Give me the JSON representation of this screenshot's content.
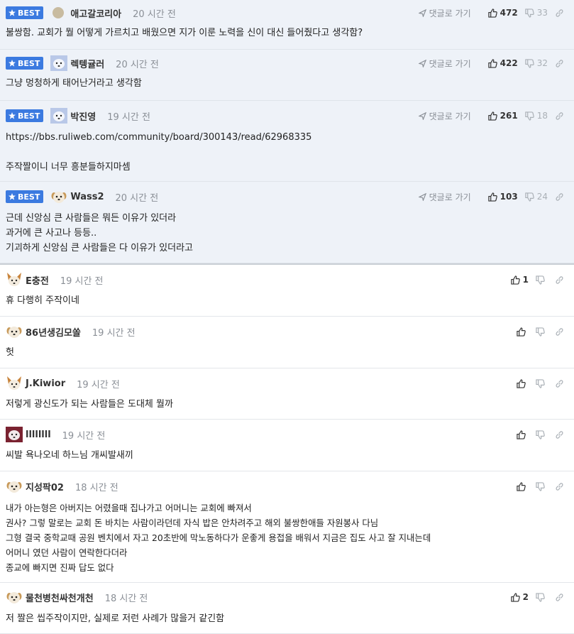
{
  "ui": {
    "best_label": "BEST",
    "reply_label": "댓글로 가기"
  },
  "best_comments": [
    {
      "nick": "애고갈코리아",
      "time": "20 시간 전",
      "up": "472",
      "down": "33",
      "avatar": "circle-avatar",
      "body": "불쌍함. 교회가 뭘 어떻게 가르치고 배웠으면 지가 이룬 노력을 신이 대신 들어줬다고 생각함?"
    },
    {
      "nick": "렉텡귤러",
      "time": "20 시간 전",
      "up": "422",
      "down": "32",
      "avatar": "white-dog-avatar",
      "body": "그냥 멍청하게 태어난거라고 생각함"
    },
    {
      "nick": "박진영",
      "time": "19 시간 전",
      "up": "261",
      "down": "18",
      "avatar": "white-dog-avatar",
      "body": "https://bbs.ruliweb.com/community/board/300143/read/62968335\n\n주작짤이니 너무 흥분들하지마셈"
    },
    {
      "nick": "Wass2",
      "time": "20 시간 전",
      "up": "103",
      "down": "24",
      "avatar": "puppy-avatar",
      "body": "근데 신앙심 큰 사람들은 뭐든 이유가 있더라\n과거에 큰 사고나 등등..\n기괴하게 신앙심 큰 사람들은 다 이유가 있더라고"
    }
  ],
  "comments": [
    {
      "nick": "E충전",
      "time": "19 시간 전",
      "up": "1",
      "down": "",
      "avatar": "fox-avatar",
      "body": "휴 다행히 주작이네"
    },
    {
      "nick": "86년생김모쏠",
      "time": "19 시간 전",
      "up": "",
      "down": "",
      "avatar": "puppy-avatar",
      "body": "헛"
    },
    {
      "nick": "J.Kiwior",
      "time": "19 시간 전",
      "up": "",
      "down": "",
      "avatar": "fox-avatar",
      "body": "저렇게 광신도가 되는 사람들은 도대체 뭘까"
    },
    {
      "nick": "llllllll",
      "time": "19 시간 전",
      "up": "",
      "down": "",
      "avatar": "red-dog-avatar",
      "body": "씨발 욕나오네 하느님 개씨발새끼"
    },
    {
      "nick": "지성팍02",
      "time": "18 시간 전",
      "up": "",
      "down": "",
      "avatar": "puppy-avatar",
      "body": "내가 아는형은 아버지는 어렸을때 집나가고 어머니는 교회에 빠져서\n권사? 그렇 말로는 교회 돈 바치는 사람이라던데 자식 밥은 안차려주고 해외 불쌍한애들 자원봉사 다님\n그형 결국 중학교때 공원 벤치에서 자고 20초반에 막노동하다가 운좋게 용접을 배워서 지금은 집도 사고 잘 지내는데\n어머니 였던 사람이 연락한다더라\n종교에 빠지면 진짜 답도 없다"
    },
    {
      "nick": "물천병천싸천개천",
      "time": "18 시간 전",
      "up": "2",
      "down": "",
      "avatar": "puppy-avatar",
      "body": "저 짤은 씹주작이지만, 실제로 저런 사례가 많을거 같긴함"
    }
  ]
}
